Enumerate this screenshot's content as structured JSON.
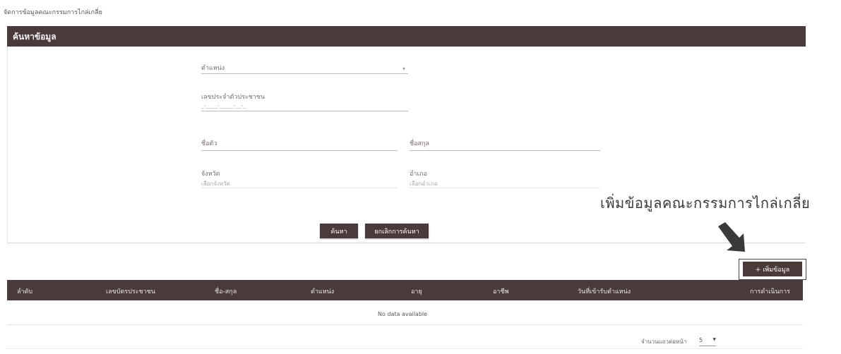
{
  "breadcrumb": "จัดการข้อมูลคณะกรรมการไกล่เกลี่ย",
  "search": {
    "title": "ค้นหาข้อมูล",
    "position_label": "ตำแหน่ง",
    "id_label": "เลขประจำตัวประชาชน",
    "id_placeholder": "_-____-_____-__-_",
    "firstname_label": "ชื่อตัว",
    "lastname_label": "ชื่อสกุล",
    "province_label": "จังหวัด",
    "province_placeholder": "เลือกจังหวัด",
    "district_label": "อำเภอ",
    "district_placeholder": "เลือกอำเภอ",
    "search_button": "ค้นหา",
    "cancel_button": "ยกเลิกการค้นหา"
  },
  "annotation": {
    "text": "เพิ่มข้อมูลคณะกรรมการไกล่เกลี่ย"
  },
  "add_button": "+ เพิ่มข้อมูล",
  "table": {
    "columns": [
      "ลำดับ",
      "เลขบัตรประชาชน",
      "ชื่อ-สกุล",
      "ตำแหน่ง",
      "อายุ",
      "อาชีพ",
      "วันที่เข้ารับตำแหน่ง",
      "การดำเนินการ"
    ],
    "empty_text": "No data available"
  },
  "pagination": {
    "rows_label": "จำนวนแถวต่อหน้า",
    "rows_value": "5"
  },
  "colors": {
    "header_bg": "#4a3a3a"
  }
}
